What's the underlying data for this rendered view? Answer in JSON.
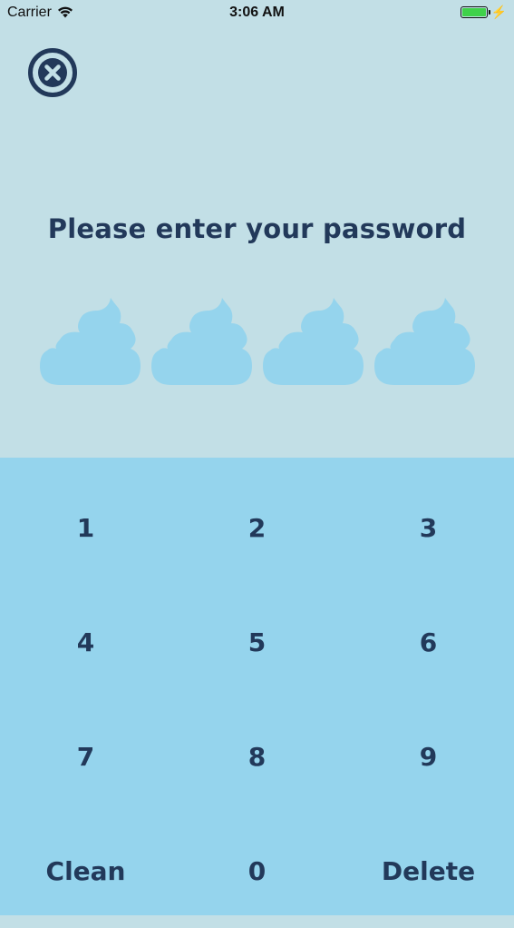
{
  "status_bar": {
    "carrier": "Carrier",
    "time": "3:06 AM",
    "icons": [
      "wifi-icon",
      "battery-icon",
      "charging-bolt-icon"
    ]
  },
  "close_button": {
    "icon": "close-circle-icon"
  },
  "prompt": {
    "title": "Please enter your password"
  },
  "password_indicators": {
    "count": 4,
    "filled": 0,
    "icon": "poop-icon"
  },
  "keypad": {
    "keys": [
      {
        "label": "1"
      },
      {
        "label": "2"
      },
      {
        "label": "3"
      },
      {
        "label": "4"
      },
      {
        "label": "5"
      },
      {
        "label": "6"
      },
      {
        "label": "7"
      },
      {
        "label": "8"
      },
      {
        "label": "9"
      },
      {
        "label": "Clean"
      },
      {
        "label": "0"
      },
      {
        "label": "Delete"
      }
    ]
  },
  "colors": {
    "top_background": "#c2dfe6",
    "keypad_background": "#95d4ed",
    "text": "#22395a",
    "indicator": "#95d4ed",
    "battery": "#3fd14a"
  }
}
